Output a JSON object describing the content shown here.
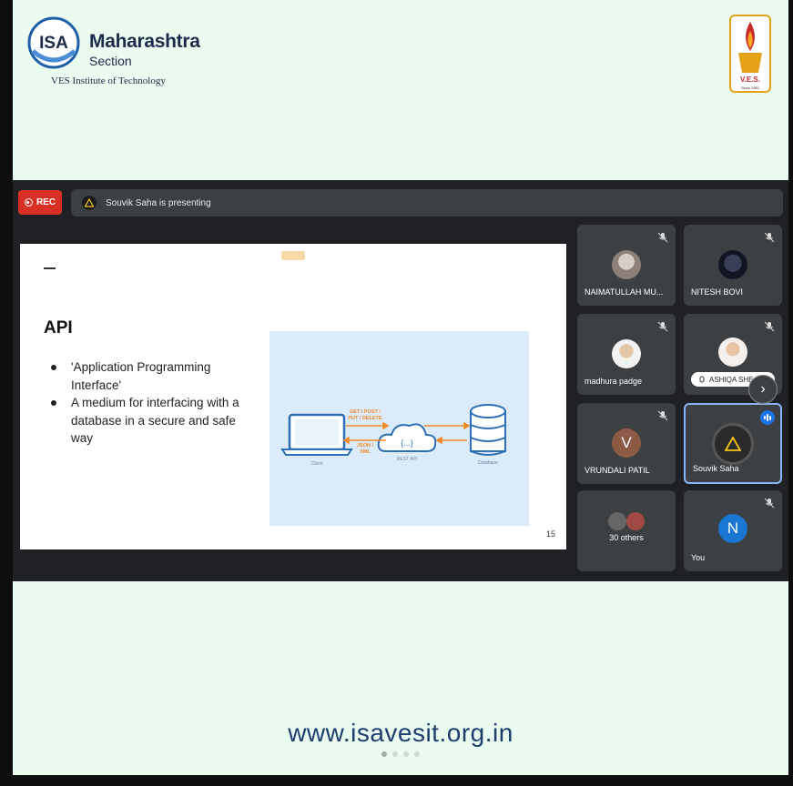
{
  "poster": {
    "isa_logo_text": "ISA",
    "title": "Maharashtra",
    "subtitle": "Section",
    "institute": "VES Institute of Technology",
    "ves_logo_text": "V.E.S.",
    "ves_since": "Since 1962",
    "url": "www.isavesit.org.in"
  },
  "meet": {
    "rec_label": "REC",
    "presenting_text": "Souvik Saha is presenting",
    "slide": {
      "heading": "API",
      "bullets": [
        "'Application Programming Interface'",
        "A medium for interfacing with a database in a secure and safe way"
      ],
      "diagram": {
        "client_label": "Client",
        "api_label": "REST API",
        "api_glyph": "{...}",
        "db_label": "Database",
        "request_label_1": "GET / POST /",
        "request_label_2": "PUT / DELETE",
        "response_label_1": "JSON /",
        "response_label_2": "XML"
      },
      "page_number": "15"
    },
    "participants": [
      {
        "name": "NAIMATULLAH MU...",
        "muted": true
      },
      {
        "name": "NITESH BOVI",
        "muted": true
      },
      {
        "name": "madhura padge",
        "muted": true
      },
      {
        "name": "ASHIQA SHE...",
        "muted": true
      },
      {
        "name": "VRUNDALI PATIL",
        "initial": "V",
        "muted": true
      },
      {
        "name": "Souvik Saha",
        "speaking": true
      },
      {
        "name": "30 others"
      },
      {
        "name": "You",
        "initial": "N",
        "muted": true
      }
    ]
  },
  "colors": {
    "rec": "#d93025",
    "meet_bg": "#202124",
    "tile_bg": "#3c4043",
    "url": "#1c3d6e",
    "poster_bg": "#eafbf0",
    "accent_blue": "#1a73e8"
  },
  "icons": [
    "isa-logo",
    "ves-logo",
    "mic-off-icon",
    "speaking-icon",
    "chevron-right-icon",
    "record-icon"
  ]
}
